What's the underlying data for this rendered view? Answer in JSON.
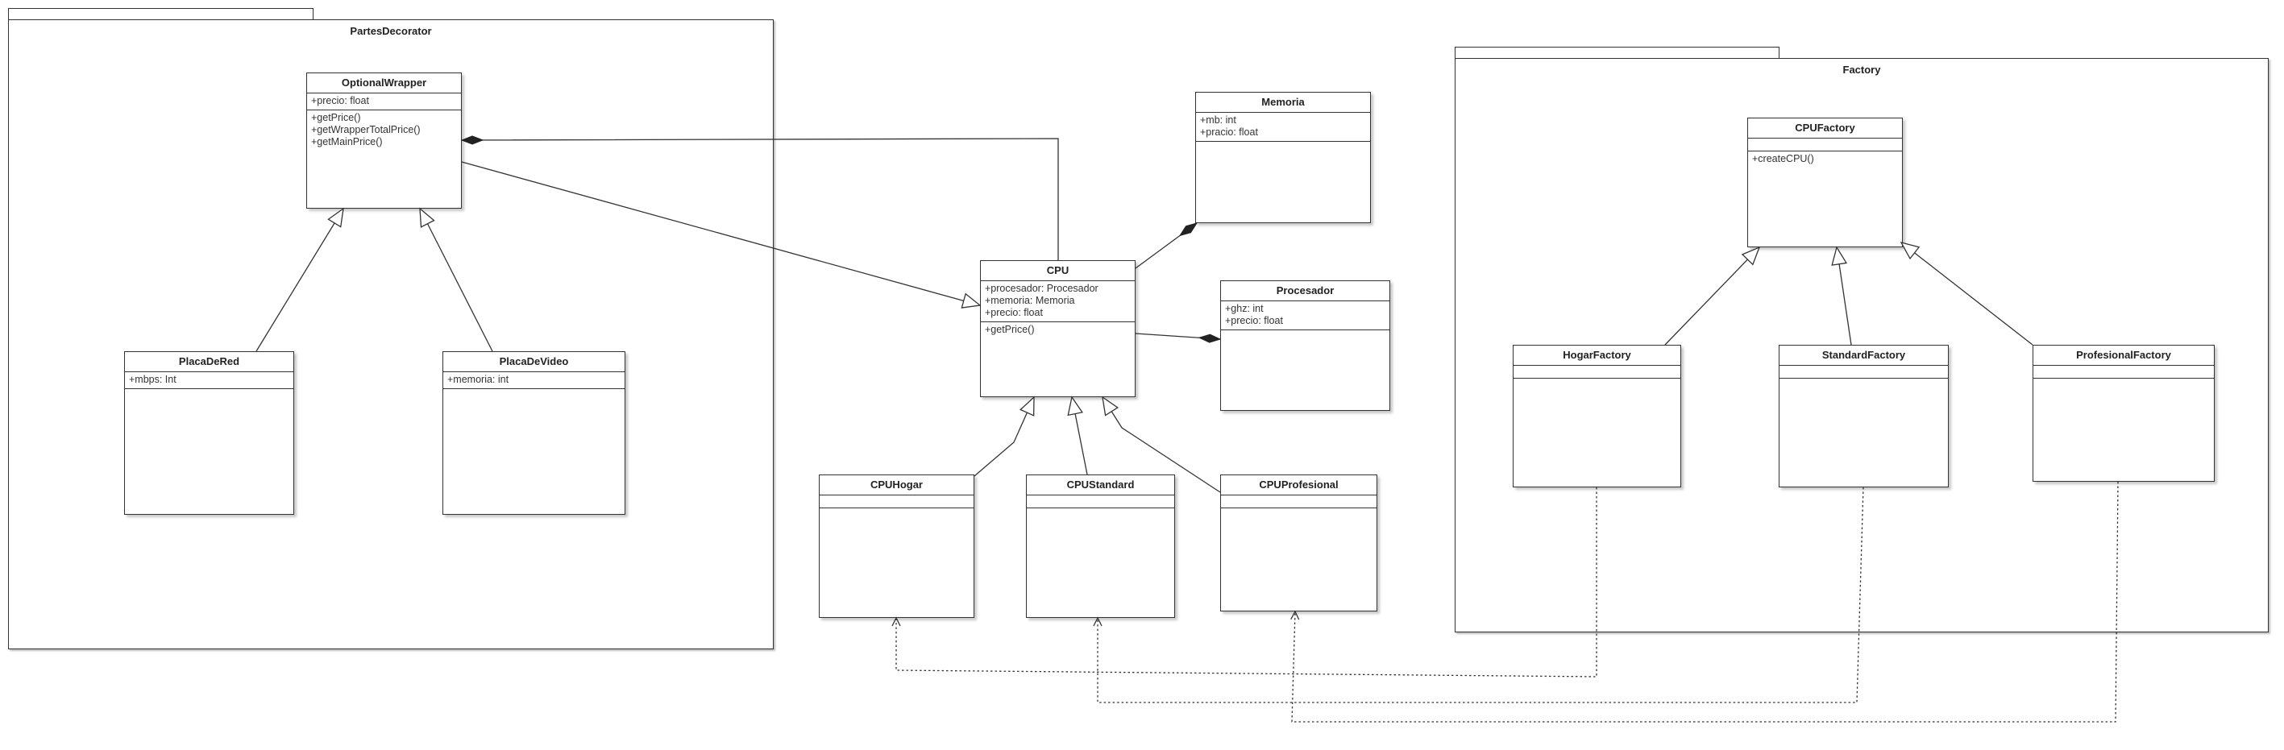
{
  "packages": {
    "partes": {
      "name": "PartesDecorator"
    },
    "factory": {
      "name": "Factory"
    }
  },
  "classes": {
    "optional_wrapper": {
      "name": "OptionalWrapper",
      "attributes": [
        "+precio: float"
      ],
      "operations": [
        "+getPrice()",
        "+getWrapperTotalPrice()",
        "+getMainPrice()"
      ]
    },
    "placa_de_red": {
      "name": "PlacaDeRed",
      "attributes": [
        "+mbps: Int"
      ],
      "operations": []
    },
    "placa_de_video": {
      "name": "PlacaDeVideo",
      "attributes": [
        "+memoria: int"
      ],
      "operations": []
    },
    "cpu": {
      "name": "CPU",
      "attributes": [
        "+procesador: Procesador",
        "+memoria: Memoria",
        "+precio: float"
      ],
      "operations": [
        "+getPrice()"
      ]
    },
    "memoria": {
      "name": "Memoria",
      "attributes": [
        "+mb: int",
        "+pracio: float"
      ],
      "operations": []
    },
    "procesador": {
      "name": "Procesador",
      "attributes": [
        "+ghz: int",
        "+precio: float"
      ],
      "operations": []
    },
    "cpu_hogar": {
      "name": "CPUHogar",
      "attributes": [],
      "operations": []
    },
    "cpu_standard": {
      "name": "CPUStandard",
      "attributes": [],
      "operations": []
    },
    "cpu_profesional": {
      "name": "CPUProfesional",
      "attributes": [],
      "operations": []
    },
    "cpu_factory": {
      "name": "CPUFactory",
      "attributes": [],
      "operations": [
        "+createCPU()"
      ]
    },
    "hogar_factory": {
      "name": "HogarFactory",
      "attributes": [],
      "operations": []
    },
    "standard_factory": {
      "name": "StandardFactory",
      "attributes": [],
      "operations": []
    },
    "profesional_factory": {
      "name": "ProfesionalFactory",
      "attributes": [],
      "operations": []
    }
  },
  "relationships": [
    {
      "type": "composition",
      "from": "cpu",
      "to": "optional_wrapper"
    },
    {
      "type": "association",
      "from": "optional_wrapper",
      "to": "cpu"
    },
    {
      "type": "composition",
      "from": "cpu",
      "to": "memoria"
    },
    {
      "type": "composition",
      "from": "cpu",
      "to": "procesador"
    },
    {
      "type": "generalization",
      "from": "placa_de_red",
      "to": "optional_wrapper"
    },
    {
      "type": "generalization",
      "from": "placa_de_video",
      "to": "optional_wrapper"
    },
    {
      "type": "generalization",
      "from": "cpu_hogar",
      "to": "cpu"
    },
    {
      "type": "generalization",
      "from": "cpu_standard",
      "to": "cpu"
    },
    {
      "type": "generalization",
      "from": "cpu_profesional",
      "to": "cpu"
    },
    {
      "type": "generalization",
      "from": "hogar_factory",
      "to": "cpu_factory"
    },
    {
      "type": "generalization",
      "from": "standard_factory",
      "to": "cpu_factory"
    },
    {
      "type": "generalization",
      "from": "profesional_factory",
      "to": "cpu_factory"
    },
    {
      "type": "dependency",
      "from": "hogar_factory",
      "to": "cpu_hogar"
    },
    {
      "type": "dependency",
      "from": "standard_factory",
      "to": "cpu_standard"
    },
    {
      "type": "dependency",
      "from": "profesional_factory",
      "to": "cpu_profesional"
    }
  ],
  "colors": {
    "line": "#333333",
    "shadow": "#c8c8c8",
    "background": "#ffffff"
  }
}
